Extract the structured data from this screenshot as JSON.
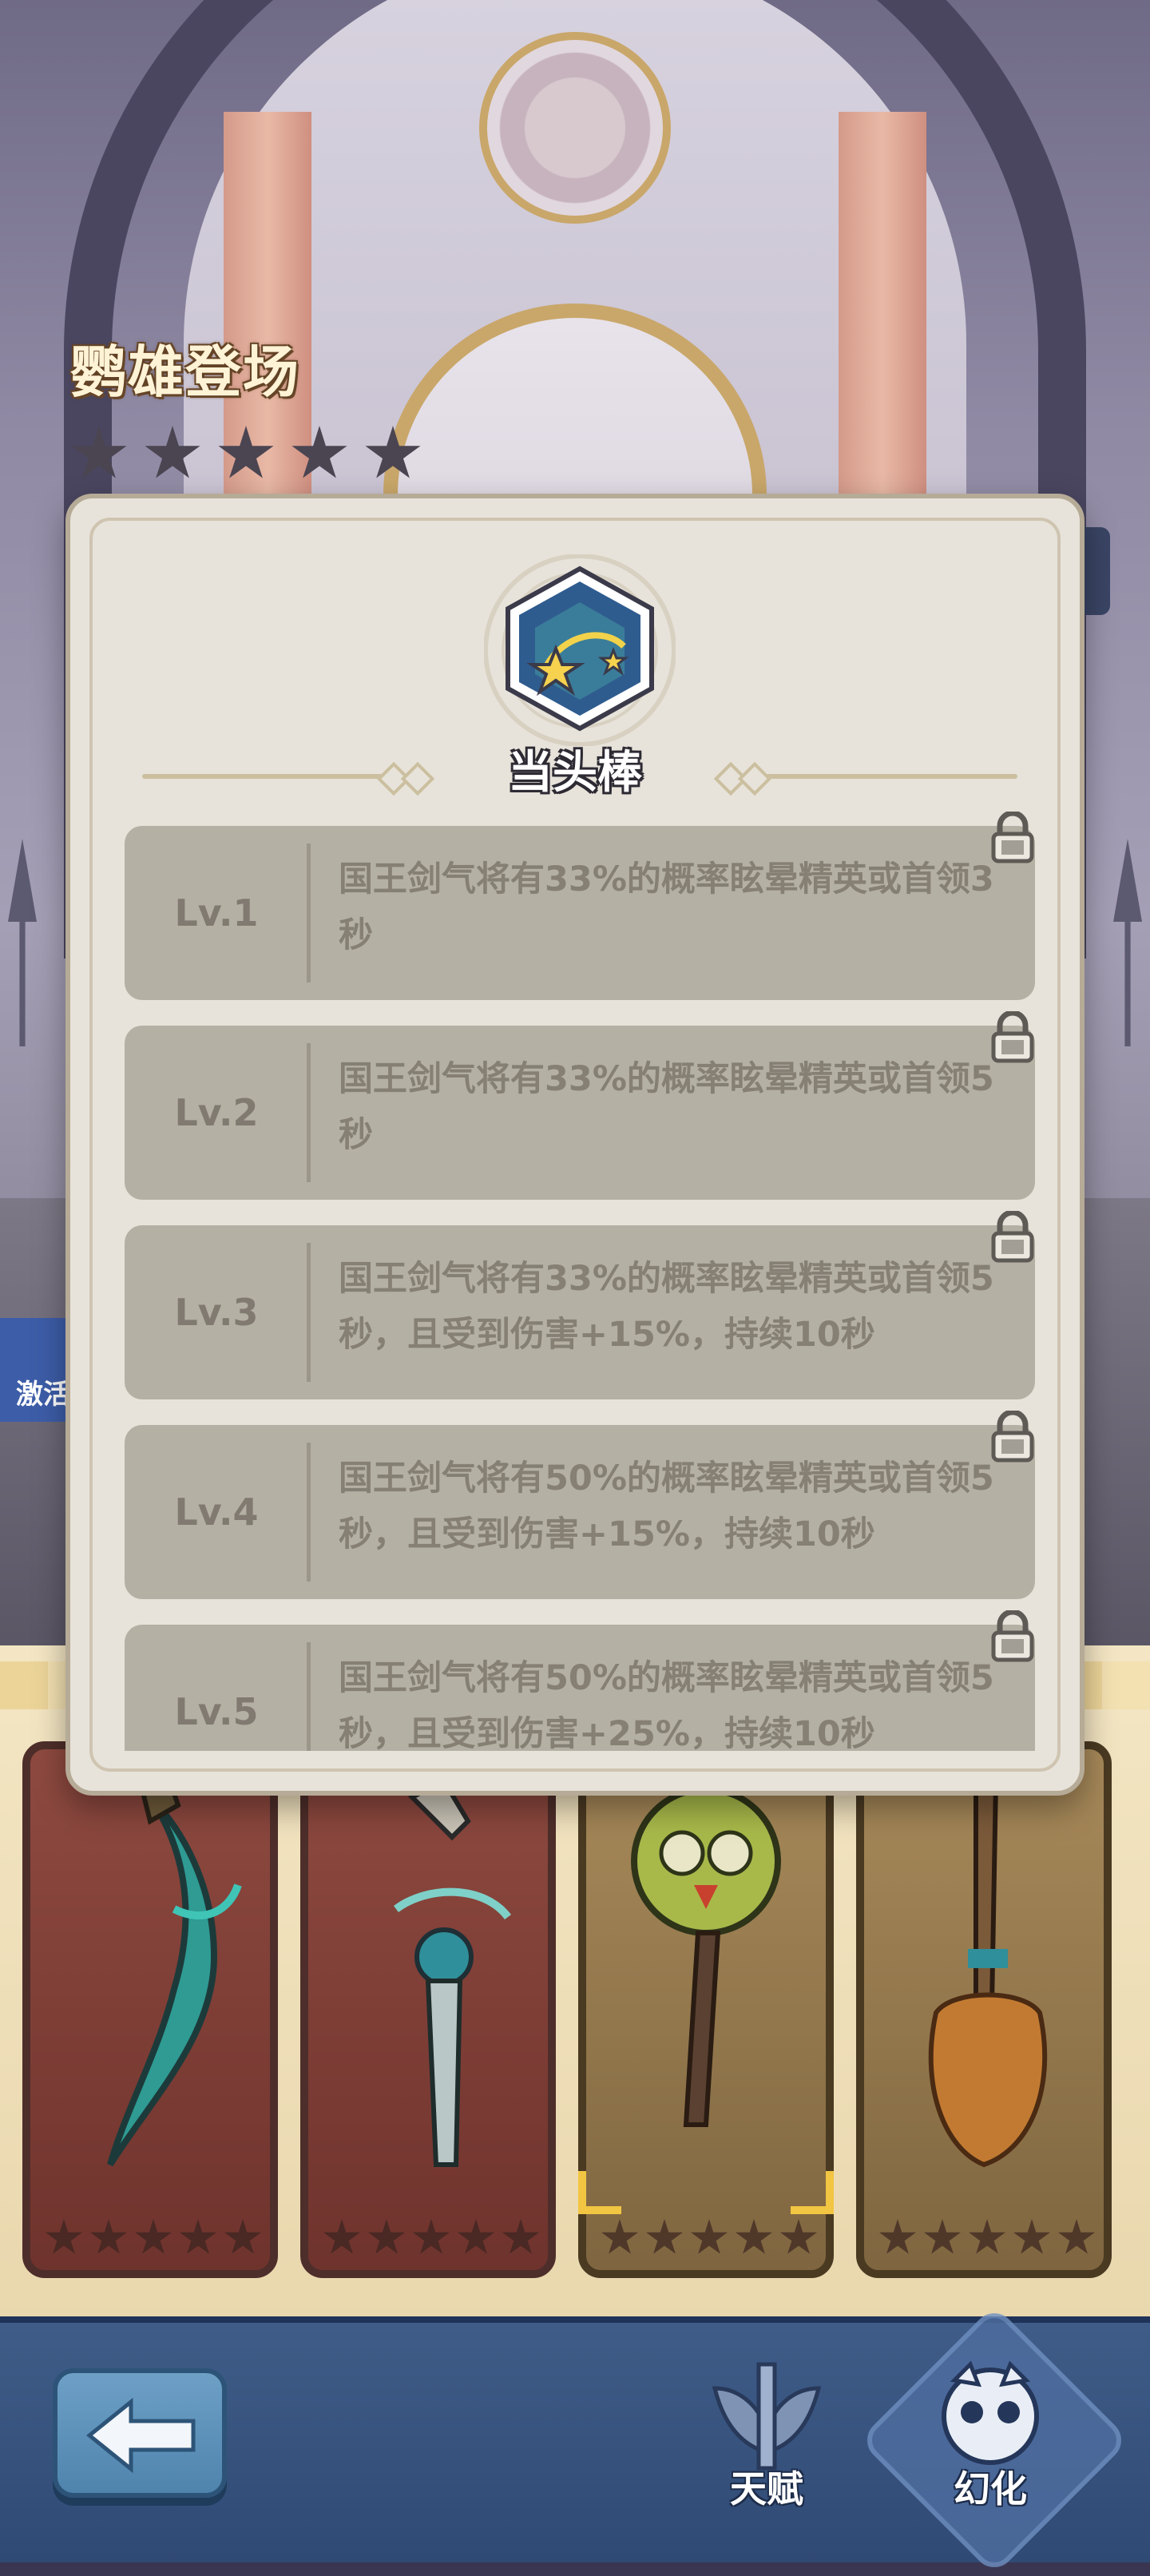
{
  "title": "鹦雄登场",
  "title_stars": 5,
  "side_badge": "激活",
  "modal": {
    "skill_name": "当头棒",
    "levels": [
      {
        "level": "Lv.1",
        "desc": "国王剑气将有33%的概率眩晕精英或首领3秒",
        "locked": true
      },
      {
        "level": "Lv.2",
        "desc": "国王剑气将有33%的概率眩晕精英或首领5秒",
        "locked": true
      },
      {
        "level": "Lv.3",
        "desc": "国王剑气将有33%的概率眩晕精英或首领5秒，且受到伤害+15%，持续10秒",
        "locked": true
      },
      {
        "level": "Lv.4",
        "desc": "国王剑气将有50%的概率眩晕精英或首领5秒，且受到伤害+15%，持续10秒",
        "locked": true
      },
      {
        "level": "Lv.5",
        "desc": "国王剑气将有50%的概率眩晕精英或首领5秒，且受到伤害+25%，持续10秒",
        "locked": true
      }
    ]
  },
  "weapons": [
    {
      "name": "green-blade",
      "frame": "red",
      "stars": 5
    },
    {
      "name": "ornate-sword",
      "frame": "red",
      "stars": 5
    },
    {
      "name": "parrot-staff",
      "frame": "gold",
      "stars": 5,
      "selected": true
    },
    {
      "name": "broom-staff",
      "frame": "gold",
      "stars": 5
    }
  ],
  "nav": {
    "back_icon": "arrow-left-icon",
    "talent_label": "天赋",
    "transform_label": "幻化"
  },
  "colors": {
    "modal_bg": "#e7e3da",
    "row_bg": "#b5b0a4",
    "row_text": "#857f74",
    "nav_bg": "#3f5c88",
    "accent_gold": "#f2c542"
  }
}
